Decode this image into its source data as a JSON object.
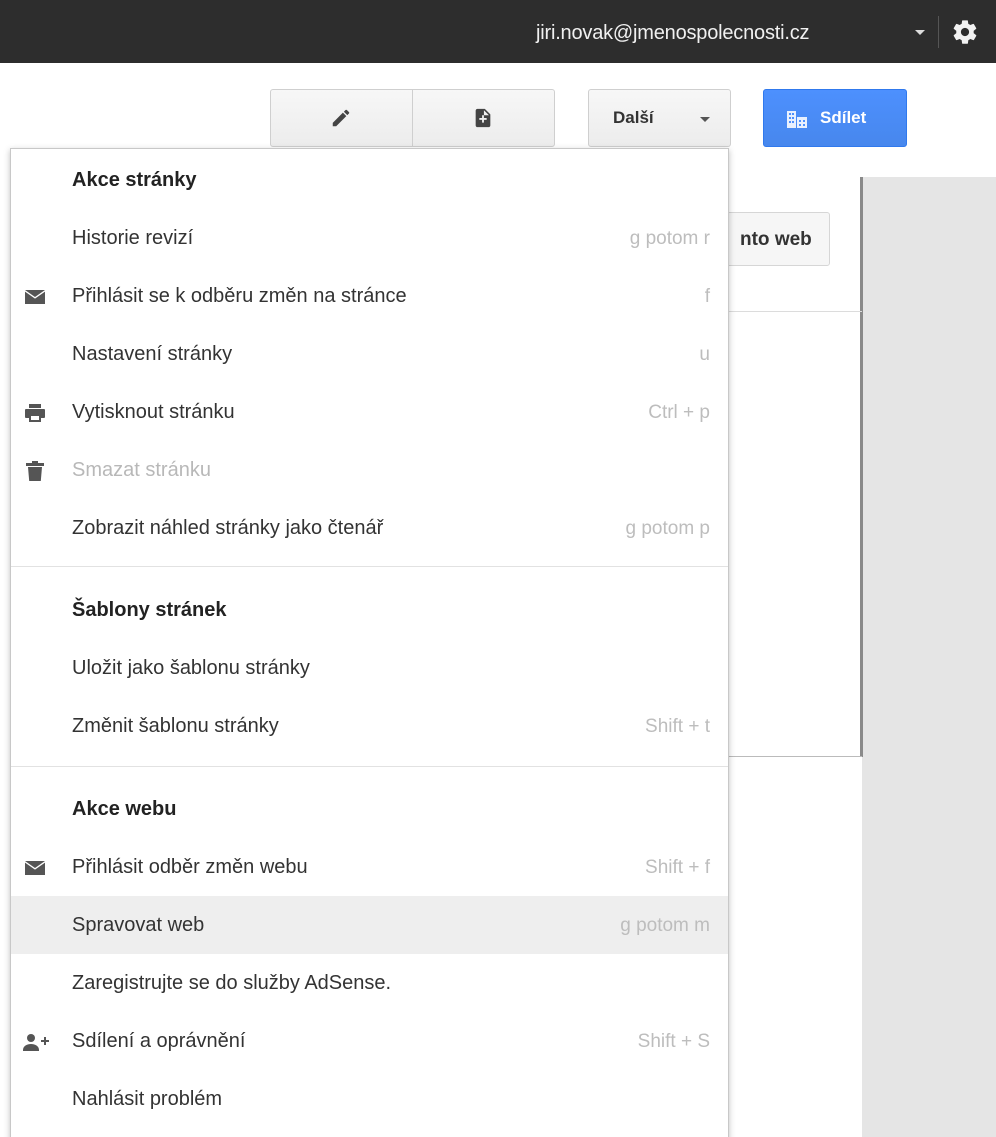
{
  "topbar": {
    "account_email": "jiri.novak@jmenospolecnosti.cz",
    "account_caret_icon": "caret-down-icon",
    "settings_icon": "gear-icon"
  },
  "toolbar": {
    "edit_icon": "pencil-icon",
    "new_page_icon": "new-page-icon",
    "more_label": "Další",
    "share_label": "Sdílet",
    "share_icon": "building-icon",
    "primary_color": "#4d90fe"
  },
  "background": {
    "partial_button_text": "nto web"
  },
  "menu": {
    "sections": [
      {
        "header": "Akce stránky",
        "items": [
          {
            "label": "Historie revizí",
            "shortcut": "g potom r",
            "icon": ""
          },
          {
            "label": "Přihlásit se k odběru změn na stránce",
            "shortcut": "f",
            "icon": "envelope-icon"
          },
          {
            "label": "Nastavení stránky",
            "shortcut": "u",
            "icon": ""
          },
          {
            "label": "Vytisknout stránku",
            "shortcut": "Ctrl + p",
            "icon": "printer-icon"
          },
          {
            "label": "Smazat stránku",
            "shortcut": "",
            "icon": "trash-icon",
            "disabled": true
          },
          {
            "label": "Zobrazit náhled stránky jako čtenář",
            "shortcut": "g potom p",
            "icon": ""
          }
        ]
      },
      {
        "header": "Šablony stránek",
        "items": [
          {
            "label": "Uložit jako šablonu stránky",
            "shortcut": "",
            "icon": ""
          },
          {
            "label": "Změnit šablonu stránky",
            "shortcut": "Shift + t",
            "icon": ""
          }
        ]
      },
      {
        "header": "Akce webu",
        "items": [
          {
            "label": "Přihlásit odběr změn webu",
            "shortcut": "Shift + f",
            "icon": "envelope-icon"
          },
          {
            "label": "Spravovat web",
            "shortcut": "g potom m",
            "icon": "",
            "highlighted": true
          },
          {
            "label": "Zaregistrujte se do služby AdSense.",
            "shortcut": "",
            "icon": ""
          },
          {
            "label": "Sdílení a oprávnění",
            "shortcut": "Shift + S",
            "icon": "add-person-icon"
          },
          {
            "label": "Nahlásit problém",
            "shortcut": "",
            "icon": ""
          }
        ]
      }
    ]
  }
}
